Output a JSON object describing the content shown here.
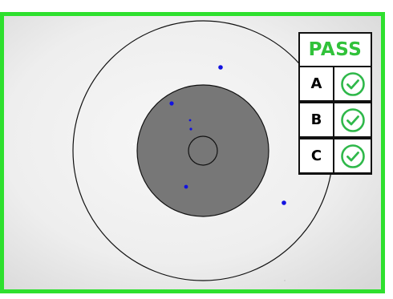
{
  "colors": {
    "frame_border": "#2ee02e",
    "pass_text": "#31c23a",
    "check_green": "#2fb84a",
    "defect_blue": "#1212e0",
    "core_gray": "#777777",
    "background": "#ececec"
  },
  "inspection": {
    "status": "PASS",
    "zones": [
      {
        "label": "A",
        "icon": "check-circle-icon"
      },
      {
        "label": "B",
        "icon": "check-circle-icon"
      },
      {
        "label": "C",
        "icon": "check-circle-icon"
      }
    ]
  }
}
